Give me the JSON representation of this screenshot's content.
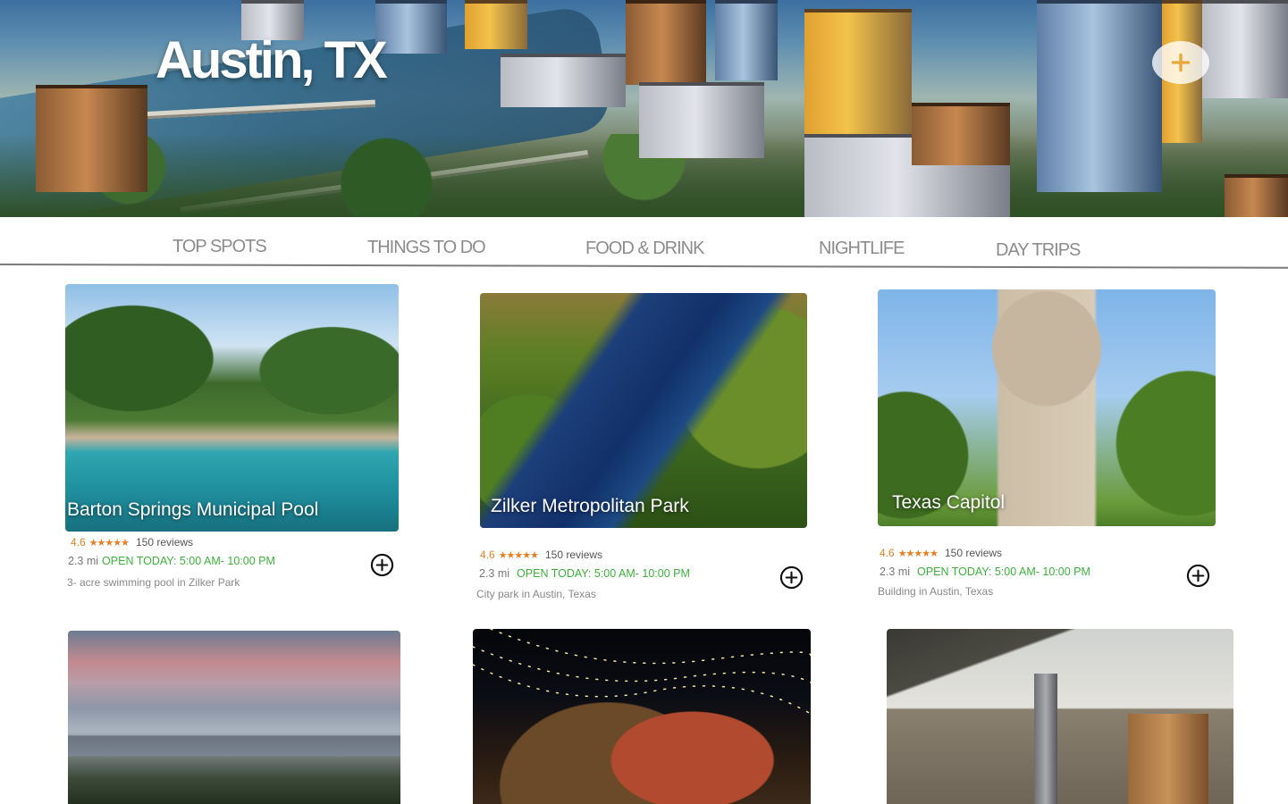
{
  "hero": {
    "title": "Austin, TX",
    "add_icon": "plus-circle-icon"
  },
  "nav": {
    "tabs": [
      "TOP SPOTS",
      "THINGS TO DO",
      "FOOD & DRINK",
      "NIGHTLIFE",
      "DAY TRIPS"
    ]
  },
  "cards": [
    {
      "title": "Barton Springs Municipal Pool",
      "rating": "4.6",
      "stars": "★★★★★",
      "reviews": "150 reviews",
      "distance": "2.3 mi",
      "hours": "OPEN TODAY: 5:00 AM- 10:00 PM",
      "description": "3- acre swimming pool in Zilker Park"
    },
    {
      "title": "Zilker Metropolitan Park",
      "rating": "4.6",
      "stars": "★★★★★",
      "reviews": "150 reviews",
      "distance": "2.3 mi",
      "hours": "OPEN TODAY: 5:00 AM- 10:00 PM",
      "description": "City park in Austin, Texas"
    },
    {
      "title": "Texas Capitol",
      "rating": "4.6",
      "stars": "★★★★★",
      "reviews": "150 reviews",
      "distance": "2.3 mi",
      "hours": "OPEN TODAY: 5:00 AM- 10:00 PM",
      "description": "Building in Austin, Texas"
    }
  ],
  "colors": {
    "accent_orange": "#e0822a",
    "open_green": "#3fae3f",
    "nav_grey": "#8c8c8c"
  }
}
